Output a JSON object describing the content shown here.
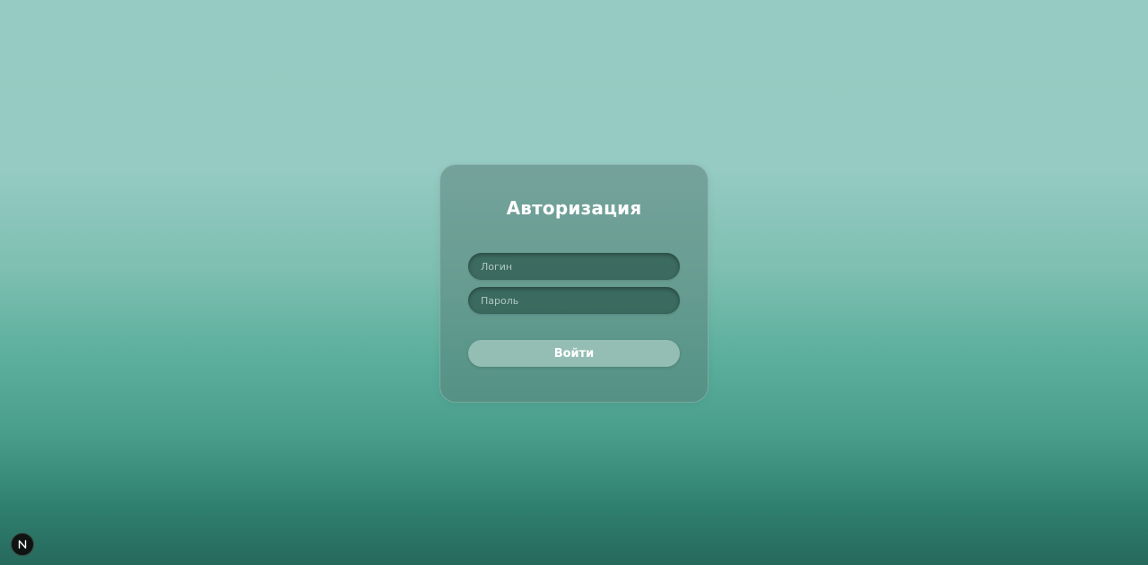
{
  "login_form": {
    "title": "Авторизация",
    "login_field": {
      "placeholder": "Логин",
      "value": ""
    },
    "password_field": {
      "placeholder": "Пароль",
      "value": ""
    },
    "submit_label": "Войти"
  },
  "dev_indicator": {
    "icon": "nextjs-logo-icon",
    "letter": "N"
  },
  "colors": {
    "background_top": "#96cbc3",
    "background_bottom": "#26695c",
    "card": "#5a827a",
    "input_fill": "#305c52",
    "button_fill": "#aacdc4",
    "text": "#ffffff"
  }
}
